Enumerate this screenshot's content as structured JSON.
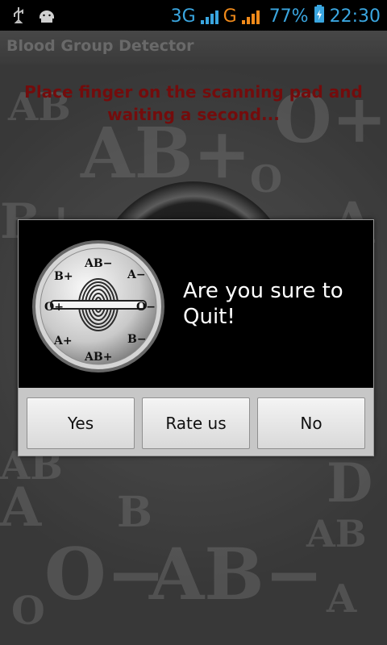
{
  "status_bar": {
    "network_1": "3G",
    "network_2": "G",
    "battery": "77%",
    "time": "22:30"
  },
  "app": {
    "title": "Blood Group Detector",
    "instruction_line1": "Place finger on the scanning pad and",
    "instruction_line2": "waiting a second..."
  },
  "background_symbols": [
    "AB+",
    "O+",
    "AB",
    "O",
    "A",
    "B+",
    "AB",
    "A",
    "B",
    "O−",
    "AB−",
    "AB",
    "A",
    "O",
    "D"
  ],
  "dialog": {
    "message": "Are you sure to Quit!",
    "badge_labels": [
      "AB−",
      "A−",
      "B+",
      "O−",
      "O+",
      "A+",
      "B−",
      "AB+"
    ],
    "buttons": {
      "yes": "Yes",
      "rate": "Rate us",
      "no": "No"
    }
  }
}
